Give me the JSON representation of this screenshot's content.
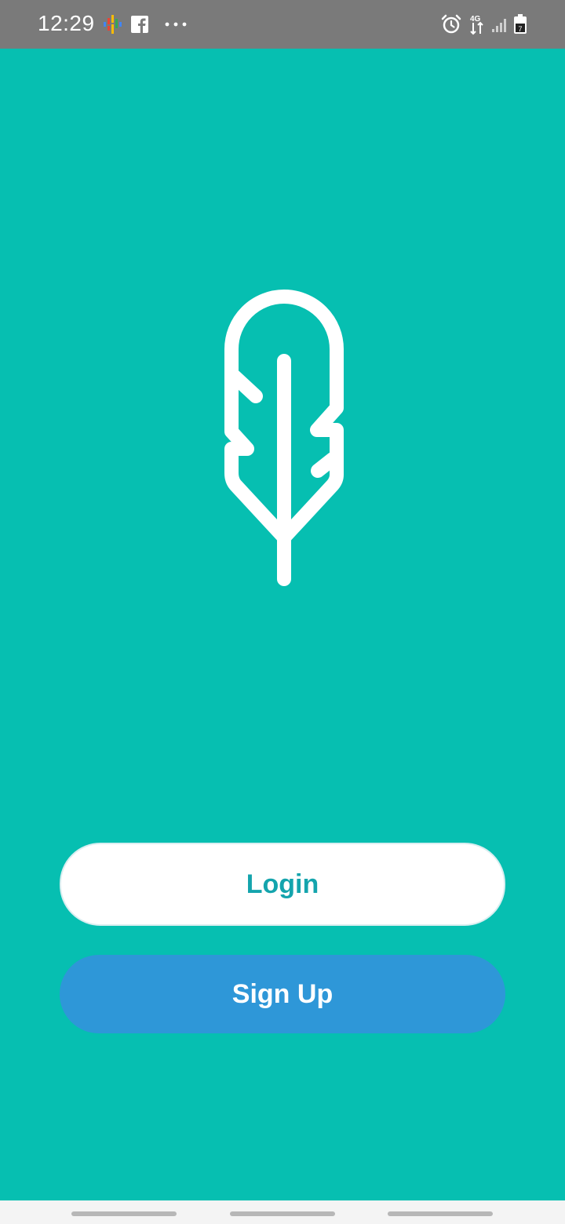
{
  "status_bar": {
    "time": "12:29",
    "battery_level": "7",
    "icons": [
      "podcast-icon",
      "facebook-icon",
      "more-dots-icon",
      "alarm-icon",
      "data-transfer-icon",
      "signal-icon",
      "battery-icon"
    ]
  },
  "logo": {
    "icon": "feather-icon",
    "color": "#ffffff"
  },
  "buttons": {
    "login_label": "Login",
    "signup_label": "Sign Up"
  },
  "colors": {
    "background": "#06bfb1",
    "login_text": "#14a4ad",
    "signup_bg": "#2e97d8",
    "status_bar": "#7a7a7a"
  }
}
